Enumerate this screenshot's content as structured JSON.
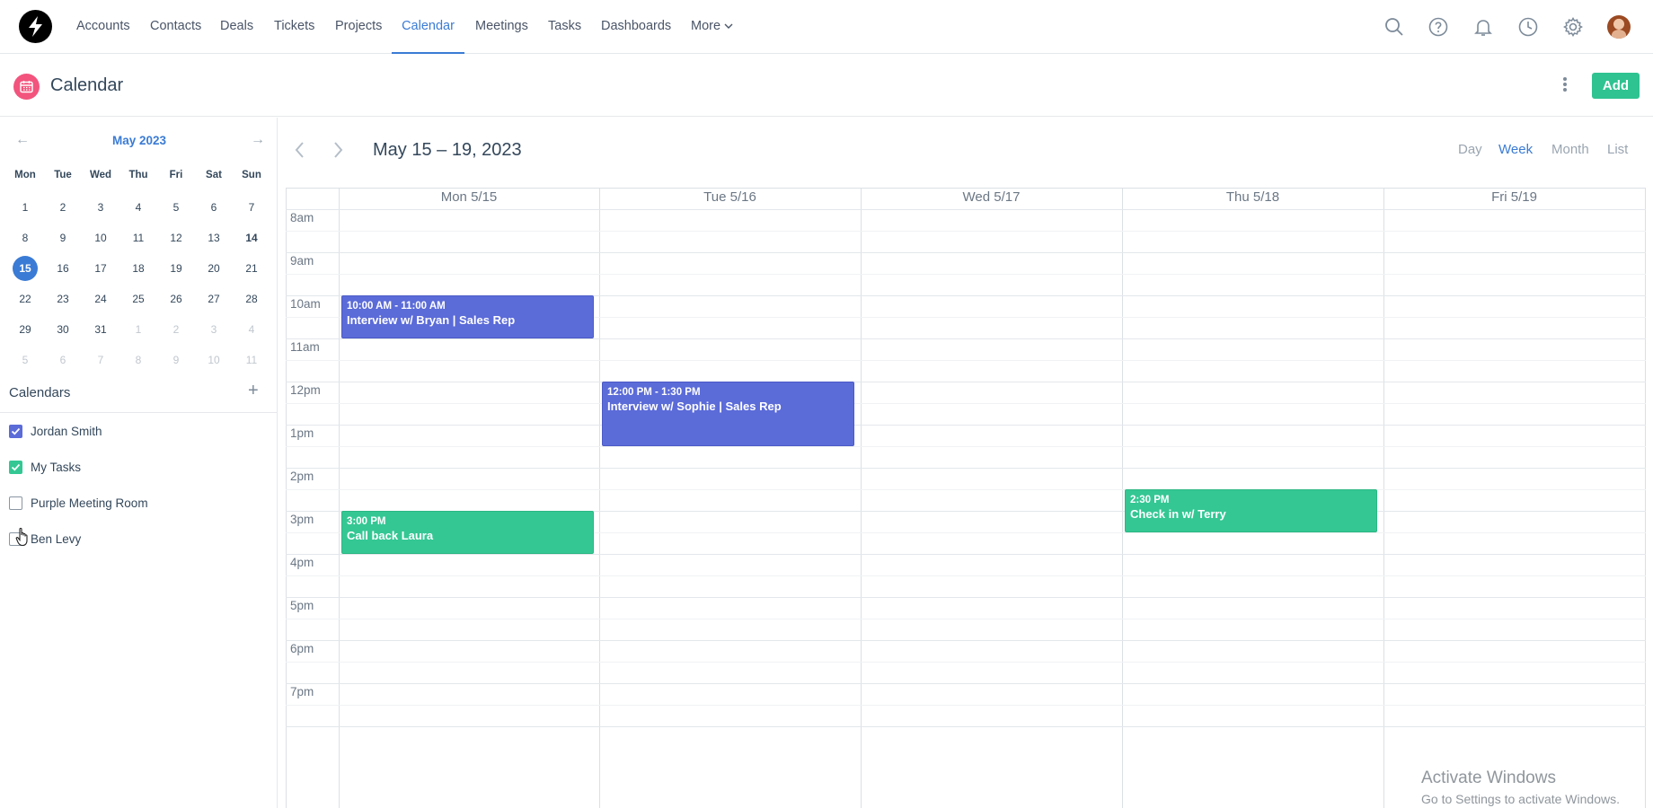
{
  "nav": {
    "items": [
      "Accounts",
      "Contacts",
      "Deals",
      "Tickets",
      "Projects",
      "Calendar",
      "Meetings",
      "Tasks",
      "Dashboards"
    ],
    "active": "Calendar",
    "more_label": "More"
  },
  "header": {
    "title": "Calendar",
    "add_label": "Add"
  },
  "mini_calendar": {
    "title": "May 2023",
    "dow": [
      "Mon",
      "Tue",
      "Wed",
      "Thu",
      "Fri",
      "Sat",
      "Sun"
    ],
    "weeks": [
      [
        "1",
        "2",
        "3",
        "4",
        "5",
        "6",
        "7"
      ],
      [
        "8",
        "9",
        "10",
        "11",
        "12",
        "13",
        "14"
      ],
      [
        "15",
        "16",
        "17",
        "18",
        "19",
        "20",
        "21"
      ],
      [
        "22",
        "23",
        "24",
        "25",
        "26",
        "27",
        "28"
      ],
      [
        "29",
        "30",
        "31",
        "1",
        "2",
        "3",
        "4"
      ],
      [
        "5",
        "6",
        "7",
        "8",
        "9",
        "10",
        "11"
      ]
    ],
    "selected": "15",
    "today": "14"
  },
  "calendars": {
    "heading": "Calendars",
    "items": [
      {
        "label": "Jordan Smith",
        "checked": true,
        "color": "#5b6bd8"
      },
      {
        "label": "My Tasks",
        "checked": true,
        "color": "#34c794"
      },
      {
        "label": "Purple Meeting Room",
        "checked": false,
        "color": "#8a96a3"
      },
      {
        "label": "Ben Levy",
        "checked": false,
        "color": "#8a96a3"
      }
    ]
  },
  "week": {
    "range_title": "May 15 – 19, 2023",
    "views": [
      "Day",
      "Week",
      "Month",
      "List"
    ],
    "active_view": "Week",
    "days": [
      "Mon 5/15",
      "Tue 5/16",
      "Wed 5/17",
      "Thu 5/18",
      "Fri 5/19"
    ],
    "hours": [
      "8am",
      "9am",
      "10am",
      "11am",
      "12pm",
      "1pm",
      "2pm",
      "3pm",
      "4pm",
      "5pm",
      "6pm",
      "7pm"
    ]
  },
  "events": [
    {
      "time": "10:00 AM - 11:00 AM",
      "title": "Interview w/ Bryan | Sales Rep",
      "color": "blue",
      "day": "Mon 5/15"
    },
    {
      "time": "12:00 PM - 1:30 PM",
      "title": "Interview w/ Sophie | Sales Rep",
      "color": "blue",
      "day": "Tue 5/16"
    },
    {
      "time": "3:00 PM",
      "title": "Call back Laura",
      "color": "green",
      "day": "Mon 5/15"
    },
    {
      "time": "2:30 PM",
      "title": "Check in w/ Terry",
      "color": "green",
      "day": "Thu 5/18"
    }
  ],
  "watermark": {
    "line1": "Activate Windows",
    "line2": "Go to Settings to activate Windows."
  },
  "colors": {
    "accent": "#3a7bd5",
    "add_button": "#2fc391",
    "event_blue": "#5b6bd8",
    "event_green": "#34c794",
    "calendar_badge": "#f2547d"
  }
}
